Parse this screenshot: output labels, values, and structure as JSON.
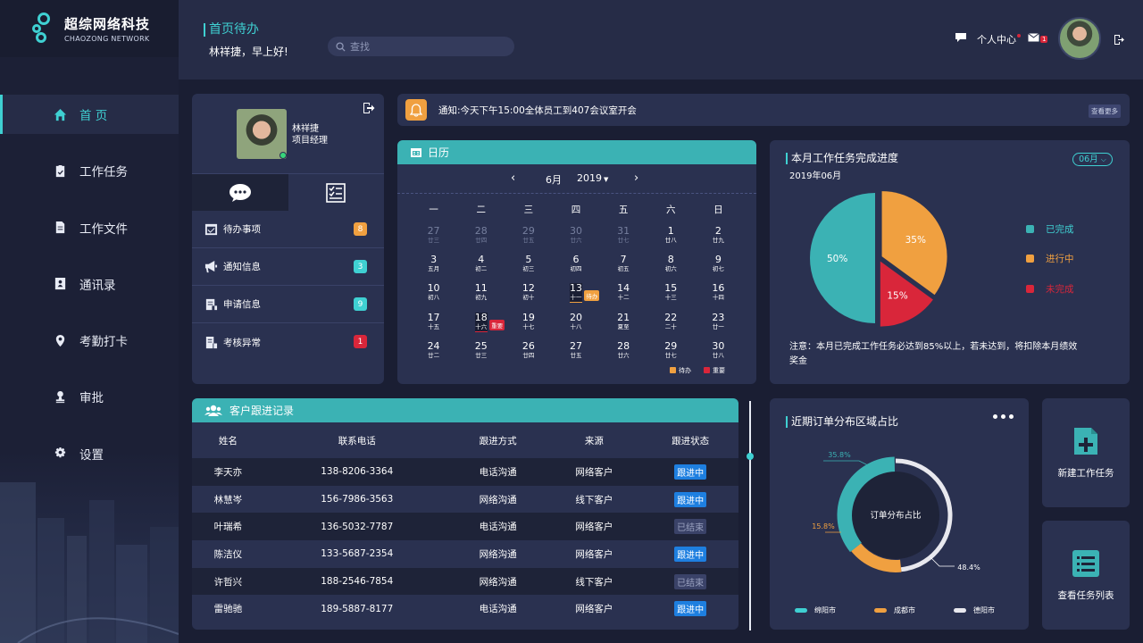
{
  "brand": {
    "name_cn": "超综网络科技",
    "name_en": "CHAOZONG NETWORK"
  },
  "nav": [
    {
      "label": "首 页",
      "icon": "home-icon",
      "active": true
    },
    {
      "label": "工作任务",
      "icon": "clipboard-icon"
    },
    {
      "label": "工作文件",
      "icon": "document-icon"
    },
    {
      "label": "通讯录",
      "icon": "contacts-icon"
    },
    {
      "label": "考勤打卡",
      "icon": "location-pin-icon"
    },
    {
      "label": "审批",
      "icon": "approval-icon"
    },
    {
      "label": "设置",
      "icon": "gear-icon"
    }
  ],
  "header": {
    "title": "首页待办",
    "greeting": "林祥捷，早上好!",
    "search_placeholder": "查找",
    "personal_center": "个人中心",
    "mail_count": "1"
  },
  "profile": {
    "name": "林祥捷",
    "role": "项目经理",
    "menu": [
      {
        "label": "待办事项",
        "count": "8",
        "color": "#f0a040"
      },
      {
        "label": "通知信息",
        "count": "3",
        "color": "#3fd0d2"
      },
      {
        "label": "申请信息",
        "count": "9",
        "color": "#3fd0d2"
      },
      {
        "label": "考核异常",
        "count": "1",
        "color": "#d9263a"
      }
    ]
  },
  "notice": {
    "text": "通知:今天下午15:00全体员工到407会议室开会",
    "more": "查看更多"
  },
  "calendar": {
    "title": "日历",
    "month": "6月",
    "year": "2019",
    "weekdays": [
      "一",
      "二",
      "三",
      "四",
      "五",
      "六",
      "日"
    ],
    "weeks": [
      [
        [
          "27",
          "廿三",
          1
        ],
        [
          "28",
          "廿四",
          1
        ],
        [
          "29",
          "廿五",
          1
        ],
        [
          "30",
          "廿六",
          1
        ],
        [
          "31",
          "廿七",
          1
        ],
        [
          "1",
          "廿八",
          0
        ],
        [
          "2",
          "廿九",
          0
        ]
      ],
      [
        [
          "3",
          "五月",
          0
        ],
        [
          "4",
          "初二",
          0
        ],
        [
          "5",
          "初三",
          0
        ],
        [
          "6",
          "初四",
          0
        ],
        [
          "7",
          "初五",
          0
        ],
        [
          "8",
          "初六",
          0
        ],
        [
          "9",
          "初七",
          0
        ]
      ],
      [
        [
          "10",
          "初八",
          0
        ],
        [
          "11",
          "初九",
          0
        ],
        [
          "12",
          "初十",
          0
        ],
        [
          "13",
          "十一",
          0
        ],
        [
          "14",
          "十二",
          0
        ],
        [
          "15",
          "十三",
          0
        ],
        [
          "16",
          "十四",
          0
        ]
      ],
      [
        [
          "17",
          "十五",
          0
        ],
        [
          "18",
          "十六",
          0
        ],
        [
          "19",
          "十七",
          0
        ],
        [
          "20",
          "十八",
          0
        ],
        [
          "21",
          "夏至",
          0
        ],
        [
          "22",
          "二十",
          0
        ],
        [
          "23",
          "廿一",
          0
        ]
      ],
      [
        [
          "24",
          "廿二",
          0
        ],
        [
          "25",
          "廿三",
          0
        ],
        [
          "26",
          "廿四",
          0
        ],
        [
          "27",
          "廿五",
          0
        ],
        [
          "28",
          "廿六",
          0
        ],
        [
          "29",
          "廿七",
          0
        ],
        [
          "30",
          "廿八",
          0
        ]
      ]
    ],
    "tags": {
      "todo": "待办",
      "important": "重要"
    },
    "legend": [
      {
        "label": "待办",
        "color": "#f0a040"
      },
      {
        "label": "重要",
        "color": "#d9263a"
      }
    ]
  },
  "progress": {
    "title": "本月工作任务完成进度",
    "subtitle": "2019年06月",
    "month_select": "06月",
    "note": "注意：本月已完成工作任务必达到85%以上，若未达到，将扣除本月绩效奖金",
    "chart_data": {
      "type": "pie",
      "slices": [
        {
          "name": "已完成",
          "value": 50,
          "label": "50%",
          "color": "#3bb2b4"
        },
        {
          "name": "进行中",
          "value": 35,
          "label": "35%",
          "color": "#f0a040"
        },
        {
          "name": "未完成",
          "value": 15,
          "label": "15%",
          "color": "#d9263a"
        }
      ]
    }
  },
  "customers": {
    "title": "客户跟进记录",
    "columns": [
      "姓名",
      "联系电话",
      "跟进方式",
      "来源",
      "跟进状态"
    ],
    "rows": [
      [
        "李天亦",
        "138-8206-3364",
        "电话沟通",
        "网络客户",
        "跟进中"
      ],
      [
        "林慧岑",
        "156-7986-3563",
        "网络沟通",
        "线下客户",
        "跟进中"
      ],
      [
        "叶瑞希",
        "136-5032-7787",
        "电话沟通",
        "网络客户",
        "已结束"
      ],
      [
        "陈洁仪",
        "133-5687-2354",
        "网络沟通",
        "网络客户",
        "跟进中"
      ],
      [
        "许哲兴",
        "188-2546-7854",
        "网络沟通",
        "线下客户",
        "已结束"
      ],
      [
        "雷驰驰",
        "189-5887-8177",
        "电话沟通",
        "网络客户",
        "跟进中"
      ]
    ]
  },
  "orders": {
    "title": "近期订单分布区域占比",
    "center_label": "订单分布占比",
    "chart_data": {
      "type": "pie",
      "series": [
        {
          "name": "绵阳市",
          "value": 35.8,
          "label": "35.8%",
          "color": "#3bb2b4"
        },
        {
          "name": "成都市",
          "value": 15.8,
          "label": "15.8%",
          "color": "#f0a040"
        },
        {
          "name": "德阳市",
          "value": 48.4,
          "label": "48.4%",
          "color": "#e8e8ee"
        }
      ]
    }
  },
  "actions": [
    {
      "label": "新建工作任务",
      "icon": "new-task-icon"
    },
    {
      "label": "查看任务列表",
      "icon": "task-list-icon"
    }
  ]
}
